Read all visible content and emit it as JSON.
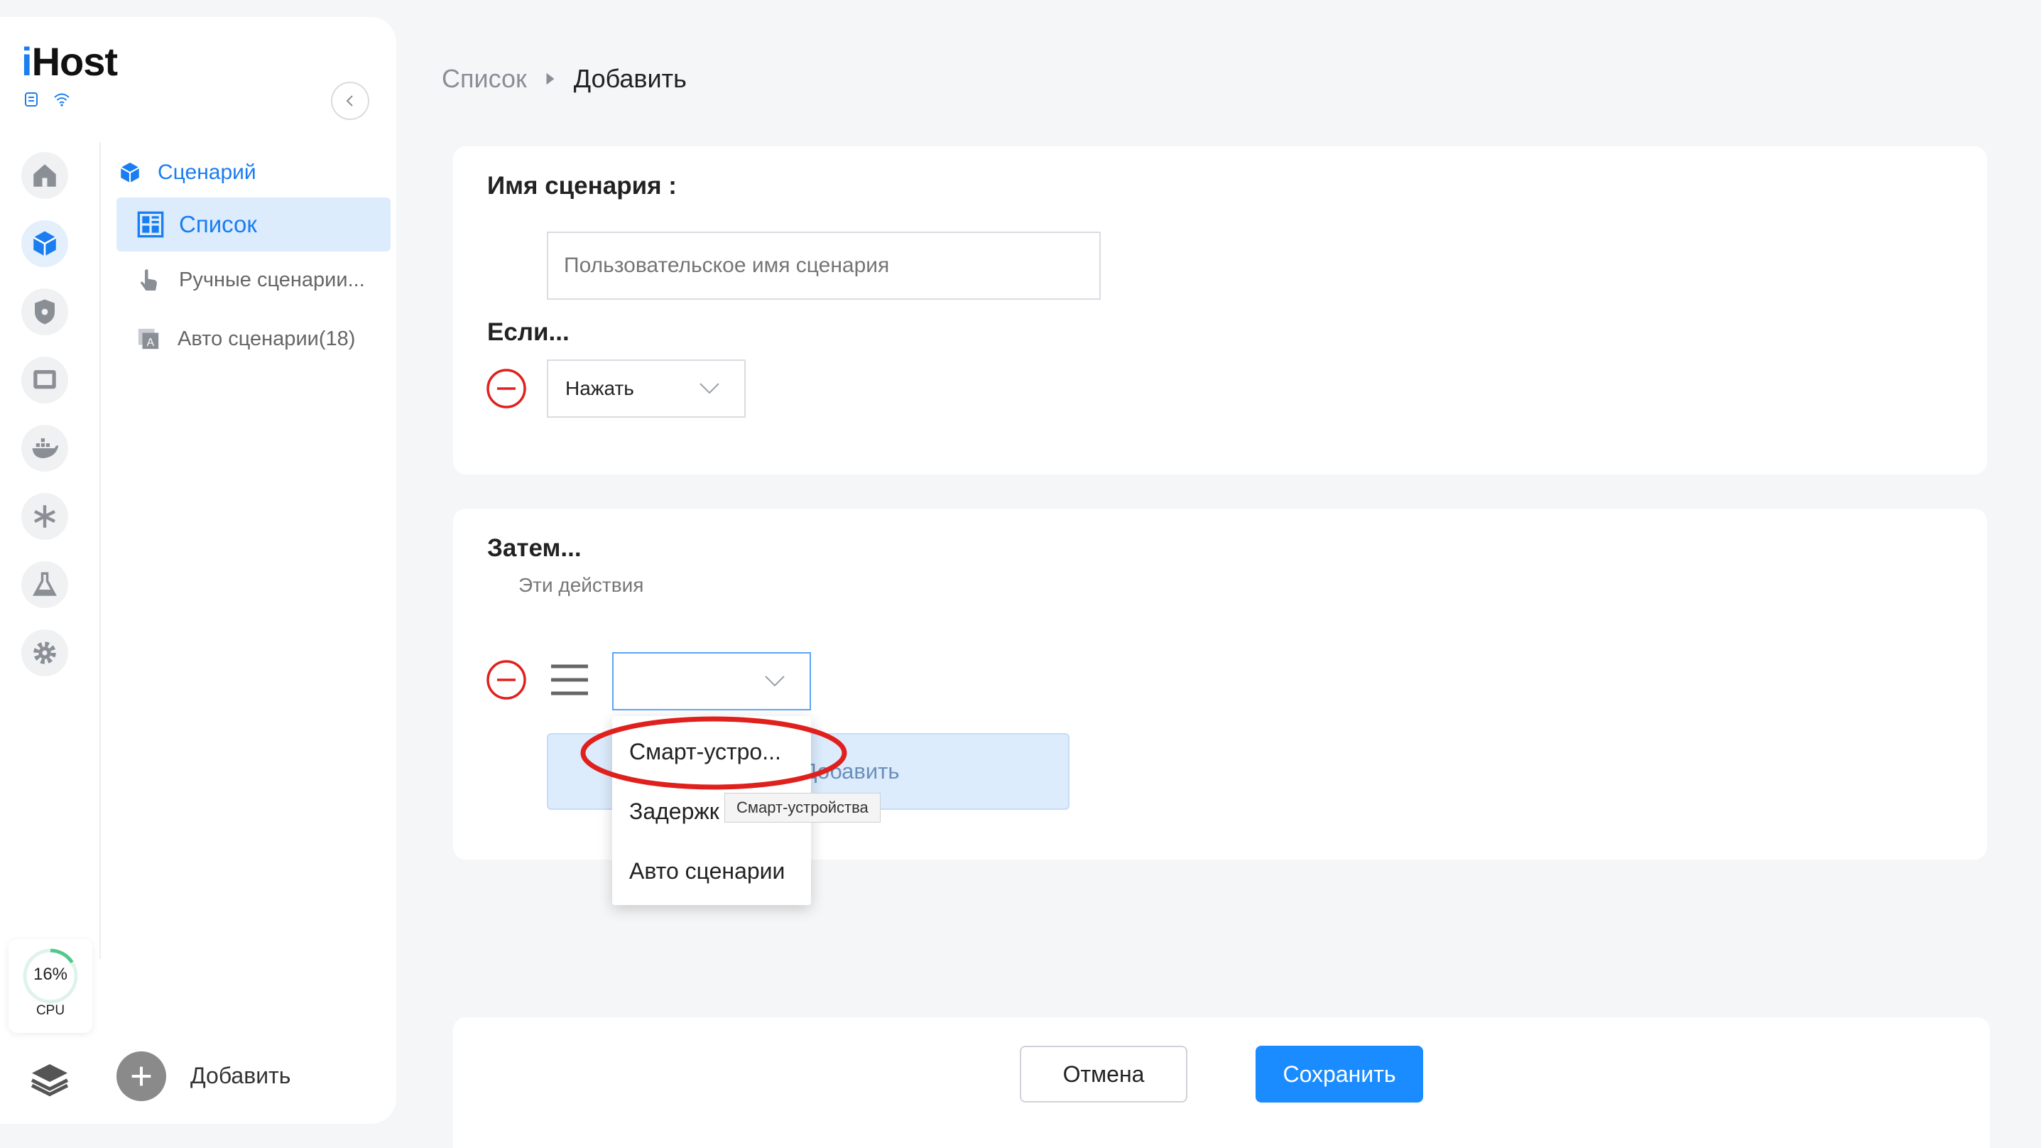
{
  "app": {
    "logo_prefix": "i",
    "logo_rest": "Host"
  },
  "breadcrumb": {
    "items": [
      "Список",
      "Добавить"
    ]
  },
  "sidebar": {
    "section_title": "Сценарий",
    "active_item": "Список",
    "items": [
      {
        "label": "Ручные сценарии..."
      },
      {
        "label": "Авто сценарии(18)"
      }
    ],
    "cpu": {
      "percent": "16%",
      "label": "CPU",
      "value": 0.16
    },
    "add_label": "Добавить"
  },
  "scene_name": {
    "title": "Имя сценария :",
    "placeholder": "Пользовательское имя сценария",
    "value": ""
  },
  "if_block": {
    "title": "Если...",
    "condition_select": "Нажать"
  },
  "then_block": {
    "title": "Затем...",
    "subtitle": "Эти действия",
    "action_select": "",
    "add_action_label": "Добавить"
  },
  "dropdown": {
    "options": [
      "Смарт-устро...",
      "Задержк",
      "Авто сценарии"
    ],
    "tooltip": "Смарт-устройства"
  },
  "footer": {
    "cancel_label": "Отмена",
    "save_label": "Сохранить"
  },
  "colors": {
    "accent": "#1a8cff",
    "danger": "#e0201c",
    "active_bg": "#dcecfd"
  }
}
